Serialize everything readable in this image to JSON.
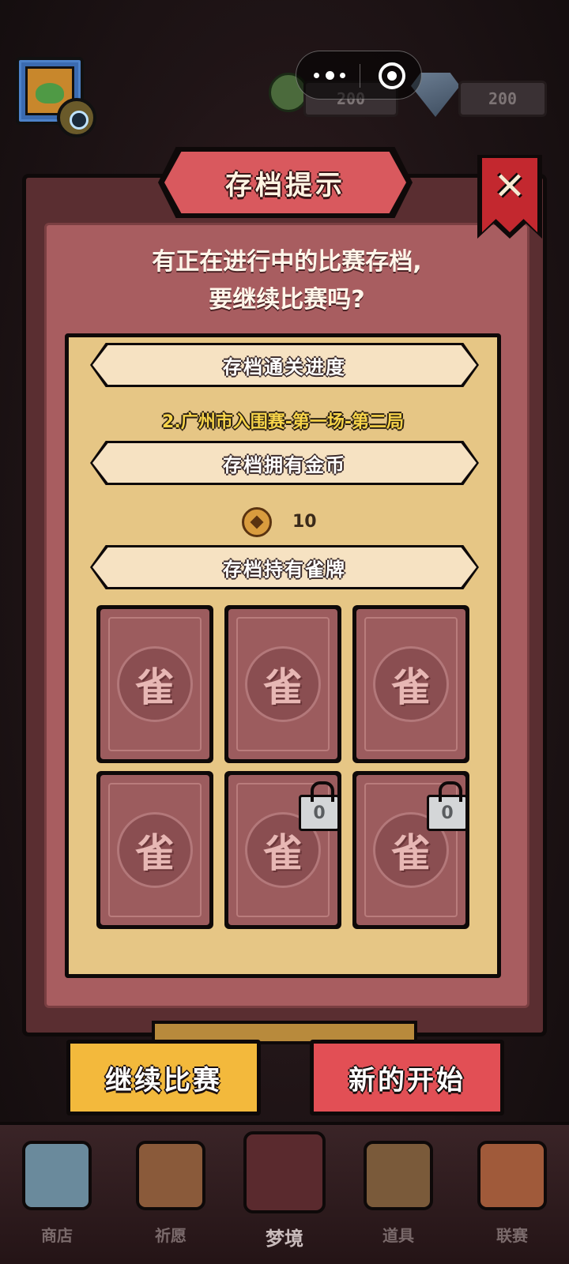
{
  "hud": {
    "green_currency": "200",
    "gem_currency": "200"
  },
  "dialog": {
    "title": "存档提示",
    "close_glyph": "✕",
    "prompt_line1": "有正在进行中的比赛存档,",
    "prompt_line2": "要继续比赛吗?",
    "sections": {
      "progress_header": "存档通关进度",
      "progress_value": "2.广州市入围赛-第一场-第二局",
      "coins_header": "存档拥有金币",
      "coins_value": "10",
      "tiles_header": "存档持有雀牌"
    },
    "tiles": [
      {
        "glyph": "雀",
        "locked": false
      },
      {
        "glyph": "雀",
        "locked": false
      },
      {
        "glyph": "雀",
        "locked": false
      },
      {
        "glyph": "雀",
        "locked": false
      },
      {
        "glyph": "雀",
        "locked": true,
        "lock_text": "0"
      },
      {
        "glyph": "雀",
        "locked": true,
        "lock_text": "0"
      }
    ],
    "buttons": {
      "continue": "继续比赛",
      "new_start": "新的开始"
    }
  },
  "nav": {
    "items": [
      {
        "label": "商店",
        "icon": "shop-icon",
        "color": "#6a8a9c"
      },
      {
        "label": "祈愿",
        "icon": "book-icon",
        "color": "#8a5a3a"
      },
      {
        "label": "梦境",
        "icon": "dream-portal-icon",
        "color": "#5a2a2e"
      },
      {
        "label": "道具",
        "icon": "tile-card-icon",
        "color": "#7a5a3a"
      },
      {
        "label": "联赛",
        "icon": "trophy-icon",
        "color": "#a05a3a"
      }
    ],
    "active_index": 2
  },
  "colors": {
    "dialog_fill": "#a85d60",
    "panel_fill": "#e6c685",
    "continue_button": "#f3b93c",
    "new_button": "#e24f55",
    "progress_text": "#f7d44a"
  }
}
